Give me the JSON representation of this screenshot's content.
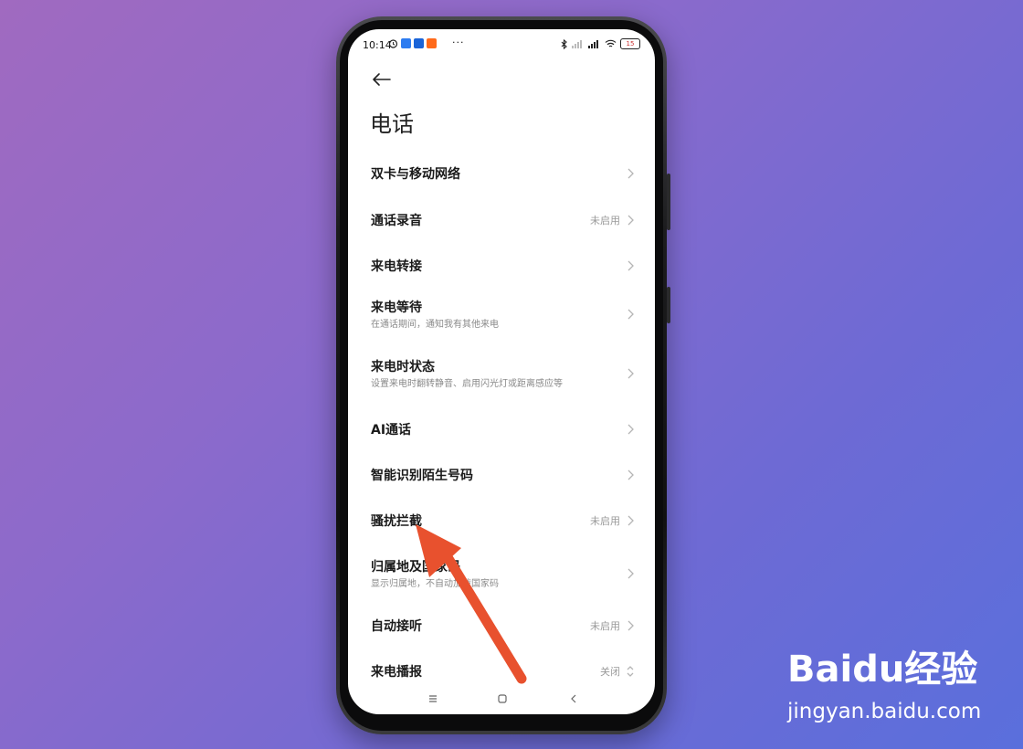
{
  "status_bar": {
    "time": "10:14",
    "overflow": "···",
    "battery": "15"
  },
  "page": {
    "title": "电话"
  },
  "settings": [
    {
      "title": "双卡与移动网络",
      "subtitle": "",
      "value": ""
    },
    {
      "title": "通话录音",
      "subtitle": "",
      "value": "未启用"
    },
    {
      "title": "来电转接",
      "subtitle": "",
      "value": ""
    },
    {
      "title": "来电等待",
      "subtitle": "在通话期间，通知我有其他来电",
      "value": ""
    },
    {
      "title": "来电时状态",
      "subtitle": "设置来电时翻转静音、启用闪光灯或距离感应等",
      "value": ""
    },
    {
      "title": "AI通话",
      "subtitle": "",
      "value": ""
    },
    {
      "title": "智能识别陌生号码",
      "subtitle": "",
      "value": ""
    },
    {
      "title": "骚扰拦截",
      "subtitle": "",
      "value": "未启用"
    },
    {
      "title": "归属地及国家码",
      "subtitle": "显示归属地，不自动加拨国家码",
      "value": ""
    },
    {
      "title": "自动接听",
      "subtitle": "",
      "value": "未启用"
    },
    {
      "title": "来电播报",
      "subtitle": "",
      "value": "关闭"
    }
  ],
  "watermark": {
    "brand": "Baidu经验",
    "url": "jingyan.baidu.com"
  },
  "colors": {
    "annotation_arrow": "#e8512e",
    "background_start": "#a06ac0",
    "background_end": "#5a6fdc"
  },
  "icons": {
    "back": "back-arrow-icon",
    "chevron": "chevron-right-icon",
    "updown": "chevron-updown-icon",
    "nav_menu": "menu-icon",
    "nav_home": "home-icon",
    "nav_back": "back-triangle-icon"
  }
}
